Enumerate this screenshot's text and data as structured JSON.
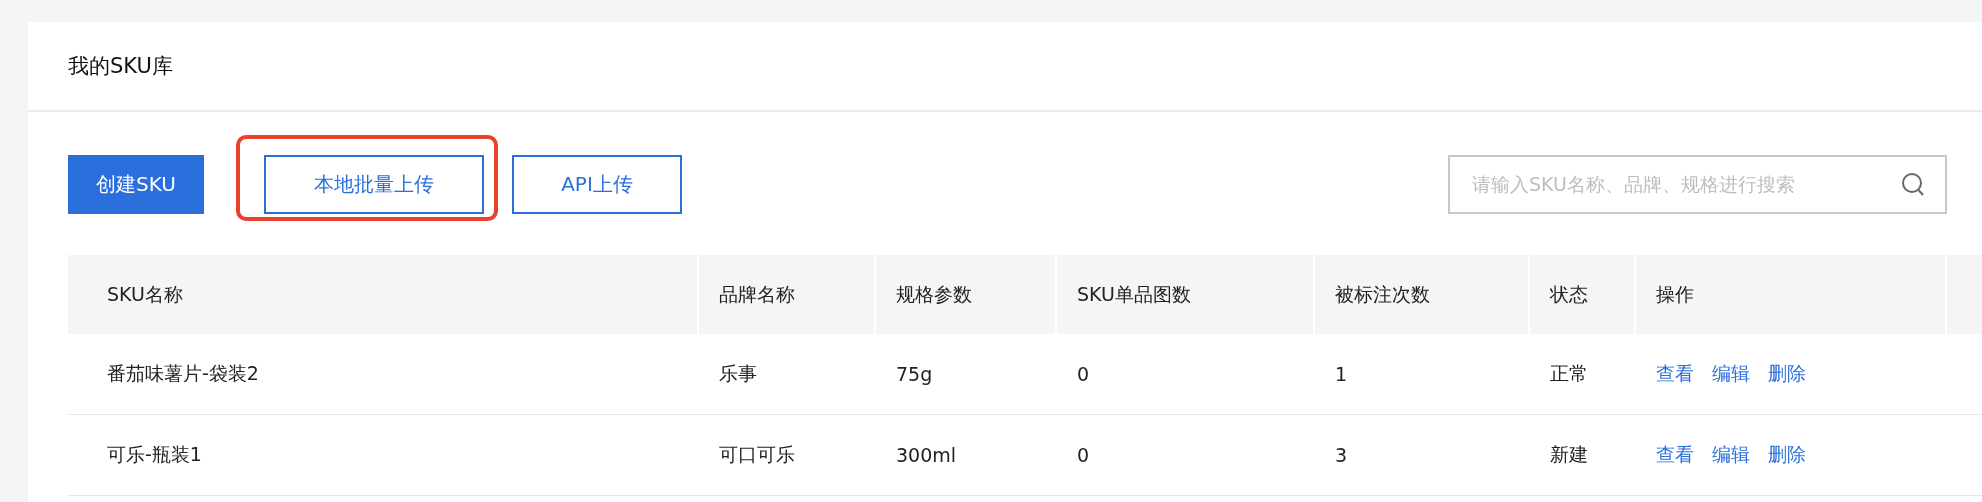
{
  "page": {
    "title": "我的SKU库"
  },
  "toolbar": {
    "buttons": [
      {
        "label": "创建SKU",
        "kind": "primary",
        "highlighted": false
      },
      {
        "label": "本地批量上传",
        "kind": "outline",
        "highlighted": true
      },
      {
        "label": "API上传",
        "kind": "outline",
        "highlighted": false
      }
    ],
    "search": {
      "placeholder": "请输入SKU名称、品牌、规格进行搜索"
    }
  },
  "table": {
    "columns": [
      "SKU名称",
      "品牌名称",
      "规格参数",
      "SKU单品图数",
      "被标注次数",
      "状态",
      "操作"
    ],
    "rows": [
      {
        "cells": [
          "番茄味薯片-袋装2",
          "乐事",
          "75g",
          "0",
          "1",
          "正常"
        ],
        "actions": [
          "查看",
          "编辑",
          "删除"
        ]
      },
      {
        "cells": [
          "可乐-瓶装1",
          "可口可乐",
          "300ml",
          "0",
          "3",
          "新建"
        ],
        "actions": [
          "查看",
          "编辑",
          "删除"
        ]
      }
    ]
  }
}
